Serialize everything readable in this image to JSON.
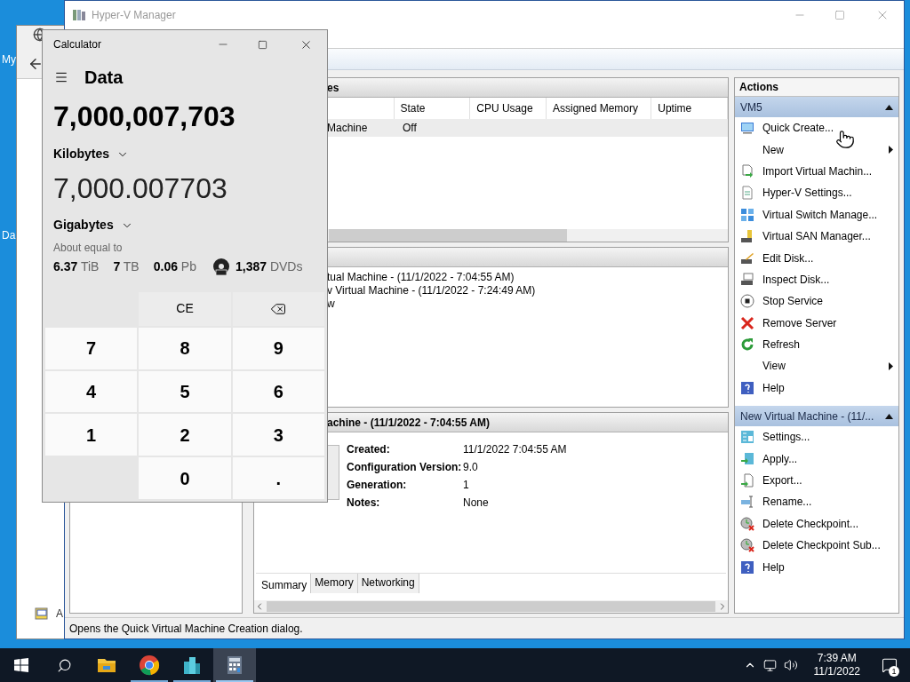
{
  "desktop": {
    "icons": [
      {
        "label": "My"
      },
      {
        "label": "Da"
      }
    ]
  },
  "back_window": {
    "text": "A"
  },
  "hyperv": {
    "title": "Hyper-V Manager",
    "vm_list": {
      "title": "es",
      "columns": [
        "State",
        "CPU Usage",
        "Assigned Memory",
        "Uptime"
      ],
      "rows": [
        {
          "name": "Machine",
          "state": "Off",
          "selected": true
        }
      ]
    },
    "checkpoints": {
      "lines": [
        "tual Machine - (11/1/2022 - 7:04:55 AM)",
        "v Virtual Machine - (11/1/2022 - 7:24:49 AM)",
        "w"
      ]
    },
    "details": {
      "title": "achine - (11/1/2022 - 7:04:55 AM)",
      "fields": [
        {
          "label": "Created:",
          "value": "11/1/2022 7:04:55 AM"
        },
        {
          "label": "Configuration Version:",
          "value": "9.0"
        },
        {
          "label": "Generation:",
          "value": "1"
        },
        {
          "label": "Notes:",
          "value": "None"
        }
      ],
      "tabs": [
        {
          "label": "Summary",
          "selected": true
        },
        {
          "label": "Memory",
          "selected": false
        },
        {
          "label": "Networking",
          "selected": false
        }
      ]
    },
    "actions": {
      "title": "Actions",
      "groups": [
        {
          "title": "VM5",
          "expanded": true,
          "items": [
            {
              "label": "Quick Create...",
              "submenu": false
            },
            {
              "label": "New",
              "submenu": true
            },
            {
              "label": "Import Virtual Machin...",
              "submenu": false
            },
            {
              "label": "Hyper-V Settings...",
              "submenu": false
            },
            {
              "label": "Virtual Switch Manage...",
              "submenu": false
            },
            {
              "label": "Virtual SAN Manager...",
              "submenu": false
            },
            {
              "label": "Edit Disk...",
              "submenu": false
            },
            {
              "label": "Inspect Disk...",
              "submenu": false
            },
            {
              "label": "Stop Service",
              "submenu": false
            },
            {
              "label": "Remove Server",
              "submenu": false
            },
            {
              "label": "Refresh",
              "submenu": false
            },
            {
              "label": "View",
              "submenu": true
            },
            {
              "label": "Help",
              "submenu": false
            }
          ]
        },
        {
          "title": "New Virtual Machine - (11/...",
          "expanded": true,
          "items": [
            {
              "label": "Settings...",
              "submenu": false
            },
            {
              "label": "Apply...",
              "submenu": false
            },
            {
              "label": "Export...",
              "submenu": false
            },
            {
              "label": "Rename...",
              "submenu": false
            },
            {
              "label": "Delete Checkpoint...",
              "submenu": false
            },
            {
              "label": "Delete Checkpoint Sub...",
              "submenu": false
            },
            {
              "label": "Help",
              "submenu": false
            }
          ]
        }
      ]
    },
    "status_bar": "Opens the Quick Virtual Machine Creation dialog."
  },
  "calculator": {
    "title": "Calculator",
    "mode": "Data",
    "input": {
      "value": "7,000,007,703",
      "unit": "Kilobytes"
    },
    "output": {
      "value": "7,000.007703",
      "unit": "Gigabytes"
    },
    "about": "About equal to",
    "equivalents": [
      {
        "value": "6.37",
        "unit": "TiB",
        "kind": "plain"
      },
      {
        "value": "7",
        "unit": "TB",
        "kind": "plain"
      },
      {
        "value": "0.06",
        "unit": "Pb",
        "kind": "plain"
      },
      {
        "value": "1,387",
        "unit": "DVDs",
        "kind": "dvd"
      }
    ],
    "keys": [
      {
        "kind": "blank"
      },
      {
        "kind": "function",
        "label": "CE"
      },
      {
        "kind": "backspace"
      },
      {
        "kind": "digit",
        "label": "7"
      },
      {
        "kind": "digit",
        "label": "8"
      },
      {
        "kind": "digit",
        "label": "9"
      },
      {
        "kind": "digit",
        "label": "4"
      },
      {
        "kind": "digit",
        "label": "5"
      },
      {
        "kind": "digit",
        "label": "6"
      },
      {
        "kind": "digit",
        "label": "1"
      },
      {
        "kind": "digit",
        "label": "2"
      },
      {
        "kind": "digit",
        "label": "3"
      },
      {
        "kind": "blank"
      },
      {
        "kind": "digit",
        "label": "0"
      },
      {
        "kind": "digit",
        "label": "."
      }
    ]
  },
  "taskbar": {
    "apps": [
      {
        "kind": "explorer",
        "running": false,
        "active": false
      },
      {
        "kind": "browser",
        "running": true,
        "active": false
      },
      {
        "kind": "server",
        "running": true,
        "active": false
      },
      {
        "kind": "calculator",
        "running": true,
        "active": true
      }
    ],
    "clock": {
      "time": "7:39 AM",
      "date": "11/1/2022"
    },
    "notifications": "1"
  }
}
